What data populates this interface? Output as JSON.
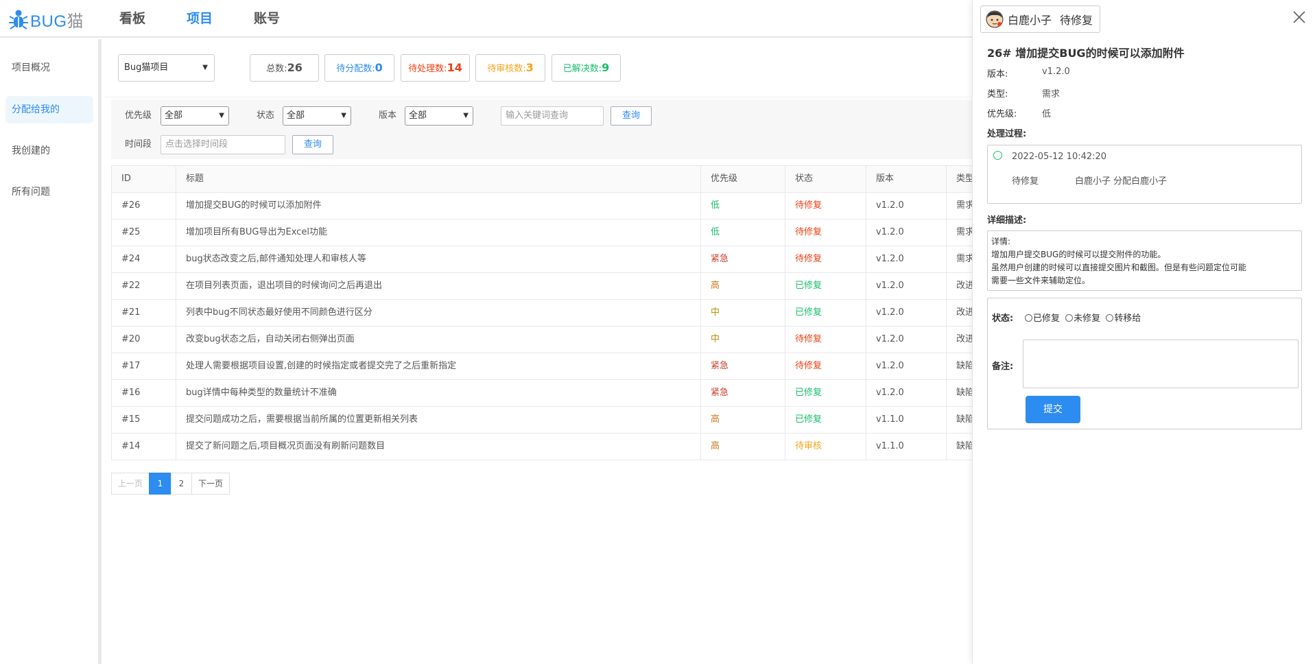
{
  "brand": {
    "logo_text": "BUG",
    "logo_text_cat": "猫"
  },
  "nav": [
    {
      "label": "看板"
    },
    {
      "label": "项目"
    },
    {
      "label": "账号"
    }
  ],
  "sidebar": {
    "items": [
      {
        "label": "项目概况"
      },
      {
        "label": "分配给我的"
      },
      {
        "label": "我创建的"
      },
      {
        "label": "所有问题"
      }
    ]
  },
  "topbar": {
    "project_select": "Bug猫项目",
    "stats": [
      {
        "label": "总数:",
        "value": "26",
        "color": "#555555"
      },
      {
        "label": "待分配数:",
        "value": "0",
        "color": "#2d8cf0"
      },
      {
        "label": "待处理数:",
        "value": "14",
        "color": "#ed4014"
      },
      {
        "label": "待审核数:",
        "value": "3",
        "color": "#f7a21b"
      },
      {
        "label": "已解决数:",
        "value": "9",
        "color": "#19be6b"
      }
    ]
  },
  "filters": {
    "priority_label": "优先级",
    "priority_value": "全部",
    "status_label": "状态",
    "status_value": "全部",
    "version_label": "版本",
    "version_value": "全部",
    "keyword_placeholder": "输入关键词查询",
    "query_button": "查询",
    "timerange_label": "时间段",
    "timerange_placeholder": "点击选择时间段",
    "query_button_2": "查询"
  },
  "table": {
    "headers": {
      "id": "ID",
      "title": "标题",
      "priority": "优先级",
      "status": "状态",
      "version": "版本",
      "type": "类型"
    },
    "rows": [
      {
        "id": "#26",
        "title": "增加提交BUG的时候可以添加附件",
        "priority": "低",
        "status": "待修复",
        "version": "v1.2.0",
        "type": "需求"
      },
      {
        "id": "#25",
        "title": "增加项目所有BUG导出为Excel功能",
        "priority": "低",
        "status": "待修复",
        "version": "v1.2.0",
        "type": "需求"
      },
      {
        "id": "#24",
        "title": "bug状态改变之后,邮件通知处理人和审核人等",
        "priority": "紧急",
        "status": "待修复",
        "version": "v1.2.0",
        "type": "需求"
      },
      {
        "id": "#22",
        "title": "在项目列表页面，退出项目的时候询问之后再退出",
        "priority": "高",
        "status": "已修复",
        "version": "v1.2.0",
        "type": "改进"
      },
      {
        "id": "#21",
        "title": "列表中bug不同状态最好使用不同颜色进行区分",
        "priority": "中",
        "status": "已修复",
        "version": "v1.2.0",
        "type": "改进"
      },
      {
        "id": "#20",
        "title": "改变bug状态之后，自动关闭右侧弹出页面",
        "priority": "中",
        "status": "待修复",
        "version": "v1.2.0",
        "type": "改进"
      },
      {
        "id": "#17",
        "title": "处理人需要根据项目设置,创建的时候指定或者提交完了之后重新指定",
        "priority": "紧急",
        "status": "待修复",
        "version": "v1.2.0",
        "type": "缺陷"
      },
      {
        "id": "#16",
        "title": "bug详情中每种类型的数量统计不准确",
        "priority": "紧急",
        "status": "已修复",
        "version": "v1.2.0",
        "type": "缺陷"
      },
      {
        "id": "#15",
        "title": "提交问题成功之后，需要根据当前所属的位置更新相关列表",
        "priority": "高",
        "status": "已修复",
        "version": "v1.1.0",
        "type": "缺陷"
      },
      {
        "id": "#14",
        "title": "提交了新问题之后,项目概况页面没有刷新问题数目",
        "priority": "高",
        "status": "待审核",
        "version": "v1.1.0",
        "type": "缺陷"
      }
    ]
  },
  "colors": {
    "priority": {
      "低": "#19be6b",
      "紧急": "#c8412b",
      "高": "#c57a1d",
      "中": "#b8900a"
    },
    "status": {
      "待修复": "#ed4014",
      "已修复": "#19be6b",
      "待审核": "#f7a21b"
    }
  },
  "pagination": {
    "prev": "上一页",
    "pages": [
      "1",
      "2"
    ],
    "next": "下一页"
  },
  "drawer": {
    "user_name": "白鹿小子",
    "user_status": "待修复",
    "title": "26# 增加提交BUG的时候可以添加附件",
    "version_label": "版本:",
    "version_value": "v1.2.0",
    "type_label": "类型:",
    "type_value": "需求",
    "priority_label": "优先级:",
    "priority_value": "低",
    "process_label": "处理过程:",
    "process": {
      "time": "2022-05-12 10:42:20",
      "status": "待修复",
      "desc": "白鹿小子 分配白鹿小子"
    },
    "detail_label": "详细描述:",
    "detail_lines": [
      "详情:",
      "增加用户提交BUG的时候可以提交附件的功能。",
      "虽然用户创建的时候可以直接提交图片和截图。但是有些问题定位可能",
      "需要一些文件来辅助定位。"
    ],
    "status_label": "状态:",
    "status_options": [
      "已修复",
      "未修复",
      "转移给"
    ],
    "remark_label": "备注:",
    "submit": "提交"
  }
}
